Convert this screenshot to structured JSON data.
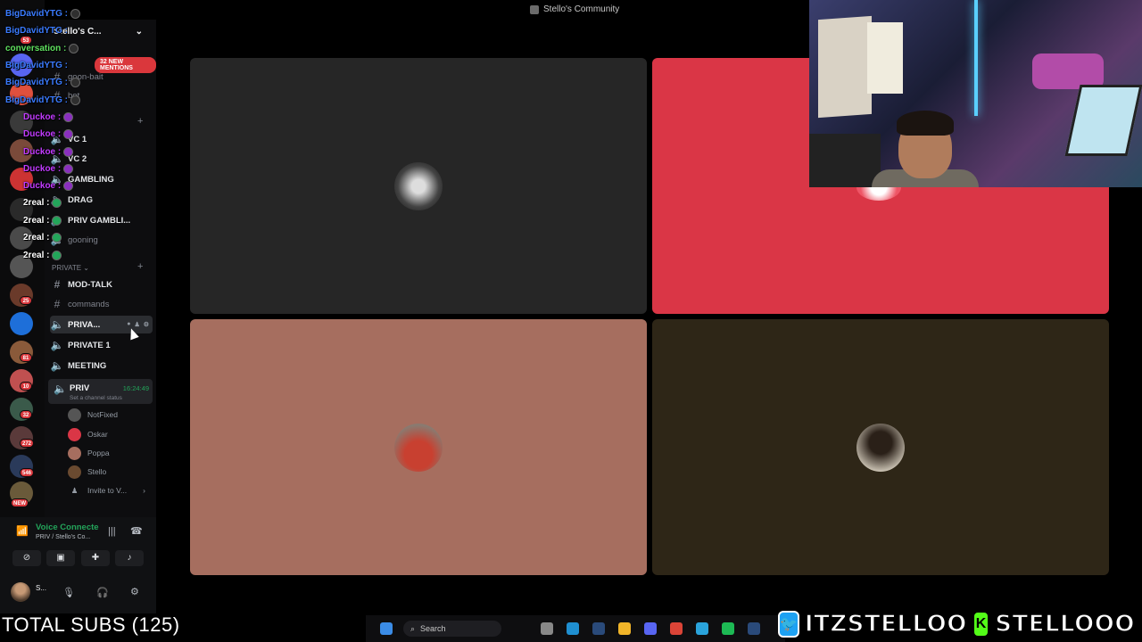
{
  "window": {
    "title": "Stello's Community"
  },
  "server": {
    "name": "Stello's C...",
    "new_mentions": "32 NEW MENTIONS"
  },
  "server_rail": {
    "badges": [
      "53",
      "25",
      "81",
      "10",
      "32",
      "272",
      "546",
      "NEW"
    ]
  },
  "channels": {
    "top": [
      "goon-bait",
      "bot",
      "VC 1",
      "VC 2",
      "GAMBLING",
      "DRAG",
      "PRIV GAMBLI...",
      "gooning"
    ],
    "private_category": "PRIVATE",
    "private": [
      "MOD-TALK",
      "commands",
      "PRIVA...",
      "PRIVATE 1",
      "MEETING"
    ],
    "active_voice": {
      "name": "PRIV",
      "time": "16:24:49",
      "status": "Set a channel status"
    },
    "members": [
      "NotFixed",
      "Oskar",
      "Poppa",
      "Stello"
    ],
    "invite": "Invite to V..."
  },
  "chat_overlay": [
    {
      "user": "BigDavidYTG :",
      "color": "#3a7bff"
    },
    {
      "user": "BigDavidYTG :",
      "color": "#3a7bff"
    },
    {
      "user": "conversation :",
      "color": "#5fe05f"
    },
    {
      "user": "BigDavidYTG :",
      "color": "#3a7bff"
    },
    {
      "user": "BigDavidYTG :",
      "color": "#3a7bff"
    },
    {
      "user": "BigDavidYTG :",
      "color": "#3a7bff"
    },
    {
      "user": "Duckoe :",
      "color": "#c23bff"
    },
    {
      "user": "Duckoe :",
      "color": "#c23bff"
    },
    {
      "user": "Duckoe :",
      "color": "#c23bff"
    },
    {
      "user": "Duckoe :",
      "color": "#c23bff"
    },
    {
      "user": "Duckoe :",
      "color": "#c23bff"
    },
    {
      "user": "2real :",
      "color": "#ffffff"
    },
    {
      "user": "2real :",
      "color": "#ffffff"
    },
    {
      "user": "2real :",
      "color": "#ffffff"
    },
    {
      "user": "2real :",
      "color": "#ffffff"
    }
  ],
  "voice_panel": {
    "title": "Voice Connecte",
    "subtitle": "PRIV / Stello's Co...",
    "user": "S..."
  },
  "total_subs": "TOTAL SUBS (125)",
  "taskbar": {
    "search": "Search"
  },
  "socials": {
    "twitter": "ITZSTELLOO",
    "kick": "STELLOOO"
  },
  "colors": {
    "tile_1": "#262626",
    "tile_2": "#da3646",
    "tile_3": "#a66e5f",
    "tile_4": "#2e2617",
    "accent_green": "#23a55a"
  }
}
